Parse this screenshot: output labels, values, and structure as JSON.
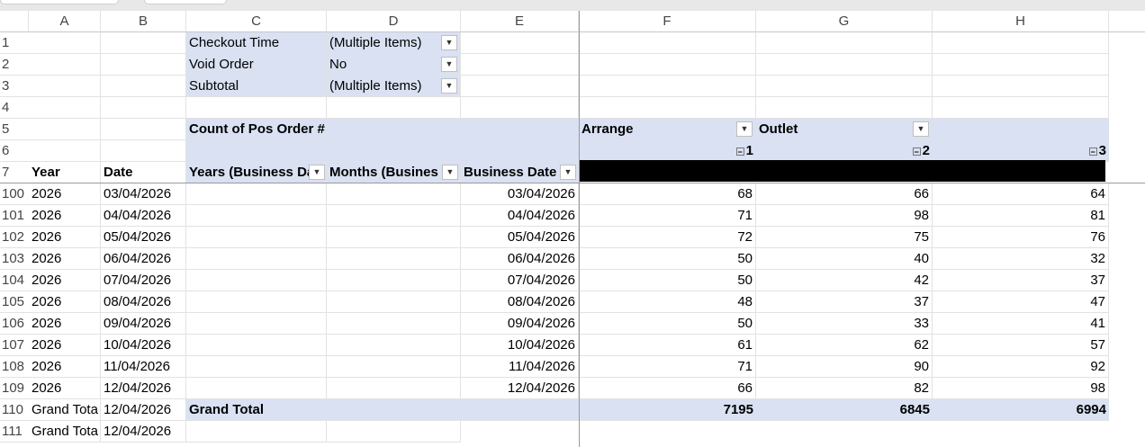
{
  "columns": [
    "A",
    "B",
    "C",
    "D",
    "E",
    "F",
    "G",
    "H"
  ],
  "filters": [
    {
      "label": "Checkout Time",
      "value": "(Multiple Items)"
    },
    {
      "label": "Void Order",
      "value": "No"
    },
    {
      "label": "Subtotal",
      "value": "(Multiple Items)"
    }
  ],
  "pivot": {
    "values_label": "Count of Pos Order #",
    "arrange_label": "Arrange",
    "outlet_label": "Outlet",
    "outlet_values": [
      "1",
      "2",
      "3"
    ],
    "hdr_year": "Year",
    "hdr_date": "Date",
    "hdr_years": "Years (Business Da",
    "hdr_months": "Months (Busines",
    "hdr_bdate": "Business Date",
    "grand_total_label": "Grand Total",
    "grand_totals": [
      "7195",
      "6845",
      "6994"
    ]
  },
  "row_numbers_top": [
    "1",
    "2",
    "3",
    "4",
    "5",
    "6",
    "7"
  ],
  "rows": [
    {
      "num": "100",
      "year": "2026",
      "date": "03/04/2026",
      "bdate": "03/04/2026",
      "v": [
        "68",
        "66",
        "64"
      ]
    },
    {
      "num": "101",
      "year": "2026",
      "date": "04/04/2026",
      "bdate": "04/04/2026",
      "v": [
        "71",
        "98",
        "81"
      ]
    },
    {
      "num": "102",
      "year": "2026",
      "date": "05/04/2026",
      "bdate": "05/04/2026",
      "v": [
        "72",
        "75",
        "76"
      ]
    },
    {
      "num": "103",
      "year": "2026",
      "date": "06/04/2026",
      "bdate": "06/04/2026",
      "v": [
        "50",
        "40",
        "32"
      ]
    },
    {
      "num": "104",
      "year": "2026",
      "date": "07/04/2026",
      "bdate": "07/04/2026",
      "v": [
        "50",
        "42",
        "37"
      ]
    },
    {
      "num": "105",
      "year": "2026",
      "date": "08/04/2026",
      "bdate": "08/04/2026",
      "v": [
        "48",
        "37",
        "47"
      ]
    },
    {
      "num": "106",
      "year": "2026",
      "date": "09/04/2026",
      "bdate": "09/04/2026",
      "v": [
        "50",
        "33",
        "41"
      ]
    },
    {
      "num": "107",
      "year": "2026",
      "date": "10/04/2026",
      "bdate": "10/04/2026",
      "v": [
        "61",
        "62",
        "57"
      ]
    },
    {
      "num": "108",
      "year": "2026",
      "date": "11/04/2026",
      "bdate": "11/04/2026",
      "v": [
        "71",
        "90",
        "92"
      ]
    },
    {
      "num": "109",
      "year": "2026",
      "date": "12/04/2026",
      "bdate": "12/04/2026",
      "v": [
        "66",
        "82",
        "98"
      ]
    }
  ],
  "grand_rows": [
    {
      "num": "110",
      "a": "Grand Tota",
      "b": "12/04/2026"
    },
    {
      "num": "111",
      "a": "Grand Tota",
      "b": "12/04/2026"
    }
  ]
}
